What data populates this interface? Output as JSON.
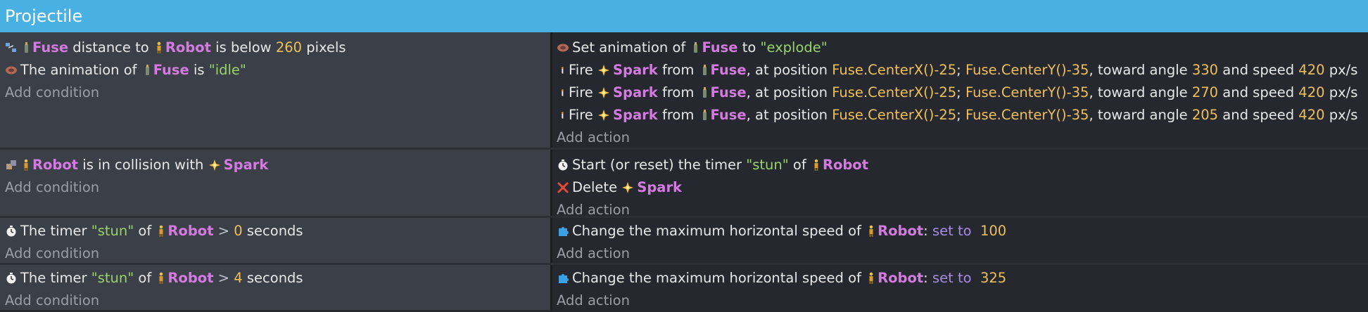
{
  "header": {
    "title": "Projectile"
  },
  "events": [
    {
      "conditions": [
        {
          "pre": "",
          "obj1": "Fuse",
          "mid": " distance to ",
          "obj2": "Robot",
          "mid2": " is below ",
          "num": "260",
          "post": " pixels"
        },
        {
          "pre": "The animation of ",
          "obj1": "Fuse",
          "mid": " is ",
          "str": "\"idle\""
        }
      ],
      "add_condition": "Add condition",
      "actions": [
        {
          "pre": "Set animation of ",
          "obj1": "Fuse",
          "mid": " to ",
          "str": "\"explode\""
        },
        {
          "pre": "Fire ",
          "obj1": "Spark",
          "mid": " from ",
          "obj2": "Fuse",
          "mid2": ", at position ",
          "x": "Fuse.CenterX()-25",
          "sep": "; ",
          "y": "Fuse.CenterY()-35",
          "mid3": ", toward angle ",
          "angle": "330",
          "mid4": " and speed ",
          "speed": "420",
          "post": " px/s"
        },
        {
          "pre": "Fire ",
          "obj1": "Spark",
          "mid": " from ",
          "obj2": "Fuse",
          "mid2": ", at position ",
          "x": "Fuse.CenterX()-25",
          "sep": "; ",
          "y": "Fuse.CenterY()-35",
          "mid3": ", toward angle ",
          "angle": "270",
          "mid4": " and speed ",
          "speed": "420",
          "post": " px/s"
        },
        {
          "pre": "Fire ",
          "obj1": "Spark",
          "mid": " from ",
          "obj2": "Fuse",
          "mid2": ", at position ",
          "x": "Fuse.CenterX()-25",
          "sep": "; ",
          "y": "Fuse.CenterY()-35",
          "mid3": ", toward angle ",
          "angle": "205",
          "mid4": " and speed ",
          "speed": "420",
          "post": " px/s"
        }
      ],
      "add_action": "Add action"
    },
    {
      "conditions": [
        {
          "obj1": "Robot",
          "mid": " is in collision with ",
          "obj2": "Spark"
        }
      ],
      "add_condition": "Add condition",
      "actions": [
        {
          "pre": "Start (or reset) the timer ",
          "str": "\"stun\"",
          "mid": " of ",
          "obj1": "Robot"
        },
        {
          "pre": "Delete ",
          "obj1": "Spark"
        }
      ],
      "add_action": "Add action"
    },
    {
      "conditions": [
        {
          "pre": "The timer ",
          "str": "\"stun\"",
          "mid": " of ",
          "obj1": "Robot",
          "op": " > ",
          "num": "0",
          "post": " seconds"
        }
      ],
      "add_condition": "Add condition",
      "actions": [
        {
          "pre": "Change the maximum horizontal speed of ",
          "obj1": "Robot",
          "colon": ": ",
          "kw": "set to",
          "num": "100"
        }
      ],
      "add_action": "Add action"
    },
    {
      "conditions": [
        {
          "pre": "The timer ",
          "str": "\"stun\"",
          "mid": " of ",
          "obj1": "Robot",
          "op": " > ",
          "num": "4",
          "post": " seconds"
        }
      ],
      "add_condition": "Add condition",
      "actions": [
        {
          "pre": "Change the maximum horizontal speed of ",
          "obj1": "Robot",
          "colon": ": ",
          "kw": "set to",
          "num": "325"
        }
      ],
      "add_action": "Add action"
    }
  ]
}
